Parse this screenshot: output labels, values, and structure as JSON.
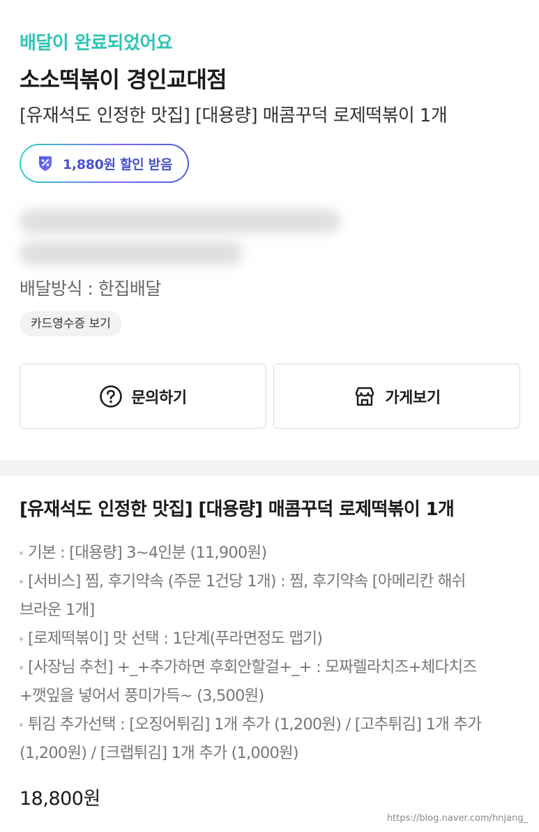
{
  "order": {
    "status": "배달이 완료되었어요",
    "store_name": "소소떡볶이 경인교대점",
    "menu_summary": "[유재석도 인정한 맛집] [대용량] 매콤꾸덕 로제떡볶이 1개",
    "discount_badge": "1,880원 할인 받음",
    "delivery_method": "배달방식 : 한집배달",
    "receipt_chip": "카드영수증 보기"
  },
  "actions": {
    "inquiry": "문의하기",
    "store": "가게보기"
  },
  "detail": {
    "title": "[유재석도 인정한 맛집] [대용량] 매콤꾸덕 로제떡볶이 1개",
    "options": [
      {
        "line1": "기본 : [대용량] 3~4인분 (11,900원)",
        "line2": ""
      },
      {
        "line1": "[서비스] 찜, 후기약속 (주문 1건당 1개) : 찜, 후기약속 [아메리칸 해쉬",
        "line2": "브라운 1개]"
      },
      {
        "line1": "[로제떡볶이] 맛 선택 : 1단계(푸라면정도 맵기)",
        "line2": ""
      },
      {
        "line1": "[사장님 추천] +_+추가하면 후회안할걸+_+ : 모짜렐라치즈+체다치즈",
        "line2": "+깻잎을 넣어서 풍미가득~ (3,500원)"
      },
      {
        "line1": "튀김 추가선택 : [오징어튀김] 1개 추가 (1,200원) / [고추튀김] 1개 추가",
        "line2": "(1,200원) / [크랩튀김] 1개 추가 (1,000원)"
      }
    ],
    "total": "18,800원"
  },
  "watermark": "https://blog.naver.com/hnjang_",
  "icons": {
    "discount": "discount-coupon-icon",
    "inquiry": "question-circle-icon",
    "store": "storefront-icon"
  },
  "colors": {
    "status": "#2ec4b6",
    "discount_text": "#4a52c9",
    "badge_gradient_start": "#2ed3c6",
    "badge_gradient_end": "#4b5de6"
  }
}
